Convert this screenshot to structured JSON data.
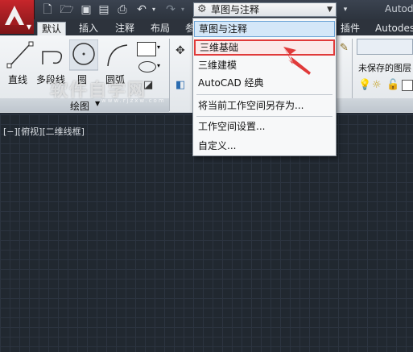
{
  "title_bar": {
    "app_title": "Autode",
    "workspace_selector": "草图与注释"
  },
  "tabs": [
    "默认",
    "插入",
    "注释",
    "布局",
    "参",
    "插件",
    "Autodesk"
  ],
  "active_tab": "默认",
  "draw_panel": {
    "tools": [
      "直线",
      "多段线",
      "圆",
      "圆弧"
    ],
    "panel_title": "绘图"
  },
  "right_panel": {
    "layer_state": "未保存的图层"
  },
  "viewport_label": "[−][俯视][二维线框]",
  "watermark": {
    "main": "软件自学网",
    "sub": "www.rjzxw.com"
  },
  "workspace_menu": {
    "items": [
      "草图与注释",
      "三维基础",
      "三维建模",
      "AutoCAD 经典"
    ],
    "selected": "草图与注释",
    "hovered": "三维基础",
    "actions": [
      "将当前工作空间另存为...",
      "工作空间设置...",
      "自定义..."
    ]
  },
  "colors": {
    "accent_red": "#e03a3a",
    "selection_blue": "#d4e7f8",
    "canvas_bg": "#212830"
  }
}
